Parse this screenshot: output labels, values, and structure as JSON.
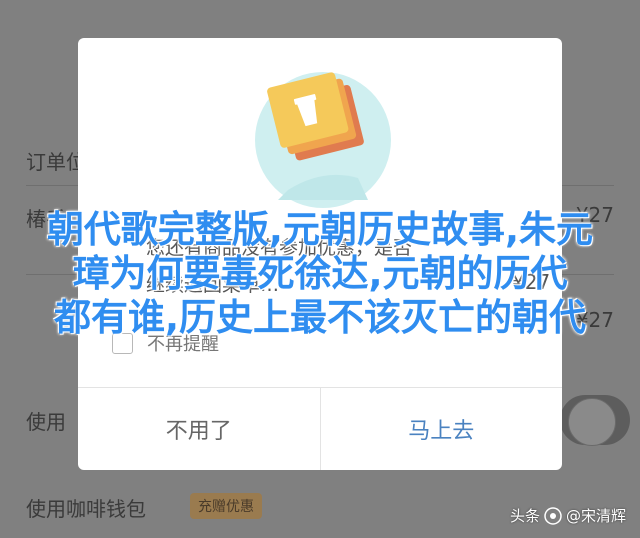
{
  "background": {
    "order_label": "订单位",
    "row1_label": "椿手",
    "row1_price": "¥27",
    "row3_price": "¥27",
    "use_label": "使用",
    "wallet_label": "使用咖啡钱包",
    "wallet_badge": "充赠优惠"
  },
  "dialog": {
    "line1": "您还有商品没有参加优惠，是否",
    "line2": "继续返回菜单…",
    "price": "¥27",
    "dont_show_again": "不再提醒",
    "cancel_label": "不用了",
    "confirm_label": "马上去"
  },
  "headline": {
    "line1": "朝代歌完整版,元朝历史故事,朱元",
    "line2": "璋为何要毒死徐达,元朝的历代",
    "line3": "都有谁,历史上最不该灭亡的朝代"
  },
  "watermark": {
    "prefix": "头条",
    "author": "@宋清辉"
  },
  "colors": {
    "headline": "#2f8df0",
    "confirm": "#4a82c0",
    "illustration_circle": "#cfeff0",
    "illustration_card": "#f5c95a"
  }
}
